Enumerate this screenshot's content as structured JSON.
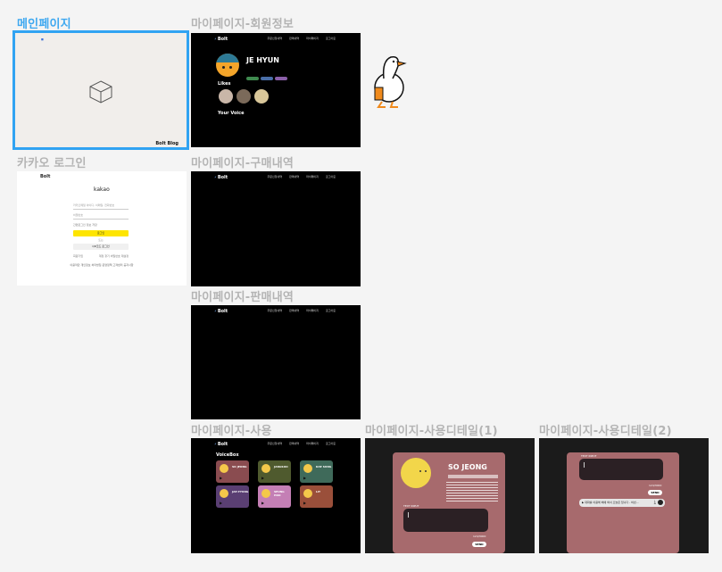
{
  "frames": {
    "main": {
      "label": "메인페이지",
      "footer_text": "Bolt Blog"
    },
    "profile": {
      "label": "마이페이지-회원정보",
      "logo": "Bolt",
      "nav": [
        "주문신청내역",
        "판매내역",
        "마이페이지",
        "로그아웃"
      ],
      "user_name": "JE HYUN",
      "likes_title": "Likes",
      "voice_title": "Your Voice"
    },
    "kakao_login": {
      "label": "카카오 로그인",
      "logo": "Bolt",
      "brand": "kakao",
      "id_placeholder": "카카오메일 아이디, 이메일, 전화번호",
      "pw_placeholder": "비밀번호",
      "keep_login": "간편로그인 정보 저장",
      "login_button": "로그인",
      "or_text": "또는",
      "qr_button": "QR코드 로그인",
      "signup_link": "회원가입",
      "find_link": "계정 찾기  비밀번호 재설정",
      "footer": "이용약관  개인정보 처리방침  운영정책  고객센터  공지사항"
    },
    "purchases": {
      "label": "마이페이지-구매내역",
      "logo": "Bolt",
      "nav": [
        "주문신청내역",
        "판매내역",
        "마이페이지",
        "로그아웃"
      ]
    },
    "sales": {
      "label": "마이페이지-판매내역",
      "logo": "Bolt",
      "nav": [
        "주문신청내역",
        "판매내역",
        "마이페이지",
        "로그아웃"
      ]
    },
    "usage": {
      "label": "마이페이지-사용",
      "logo": "Bolt",
      "nav": [
        "주문신청내역",
        "판매내역",
        "마이페이지",
        "로그아웃"
      ],
      "section_title": "VoiceBox",
      "cards": [
        {
          "name": "SO JEONG",
          "color": "#8a4c50"
        },
        {
          "name": "JANGSOO",
          "color": "#4f5a2e"
        },
        {
          "name": "KAE SUNG",
          "color": "#3f6a5a"
        },
        {
          "name": "JAE PYUNG",
          "color": "#5a3f73"
        },
        {
          "name": "SEUNG HOO",
          "color": "#c47fb5"
        },
        {
          "name": "LIT",
          "color": "#9a4f3a"
        }
      ]
    },
    "usage_detail_1": {
      "label": "마이페이지-사용디테일(1)",
      "name": "SO JEONG",
      "input_label": "TEXT INPUT",
      "counter": "124/3000",
      "send_button": "SEND"
    },
    "usage_detail_2": {
      "label": "마이페이지-사용디테일(2)",
      "input_label": "TEXT INPUT",
      "counter": "124/3000",
      "send_button": "SEND",
      "player_text": "▶ 대화를 이용해 배에 와서 오늘은 입니다 - 비빈..."
    }
  },
  "colors": {
    "selection": "#31a3f2",
    "label": "#b4b4b4",
    "kakao_yellow": "#fee500",
    "dialog": "#a76a6d"
  }
}
